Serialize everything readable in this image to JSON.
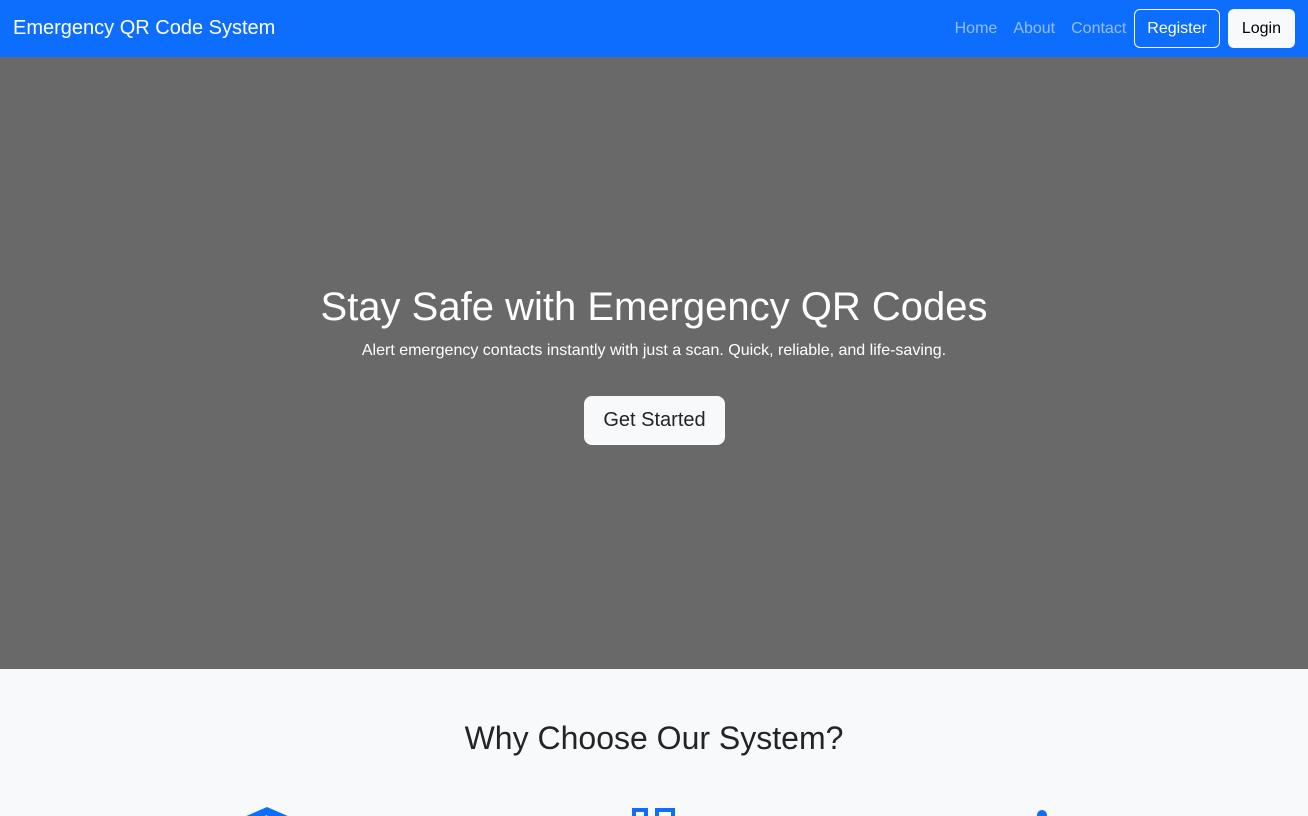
{
  "navbar": {
    "brand": "Emergency QR Code System",
    "links": [
      "Home",
      "About",
      "Contact"
    ],
    "register_label": "Register",
    "login_label": "Login"
  },
  "hero": {
    "title": "Stay Safe with Emergency QR Codes",
    "subtitle": "Alert emergency contacts instantly with just a scan. Quick, reliable, and life-saving.",
    "cta_label": "Get Started"
  },
  "features": {
    "title": "Why Choose Our System?",
    "icons": [
      "shield-icon",
      "qr-code-icon",
      "person-icon"
    ]
  },
  "colors": {
    "primary": "#0d6efd",
    "hero_bg": "#696969",
    "light": "#f8f9fa",
    "dark_text": "#212529"
  }
}
